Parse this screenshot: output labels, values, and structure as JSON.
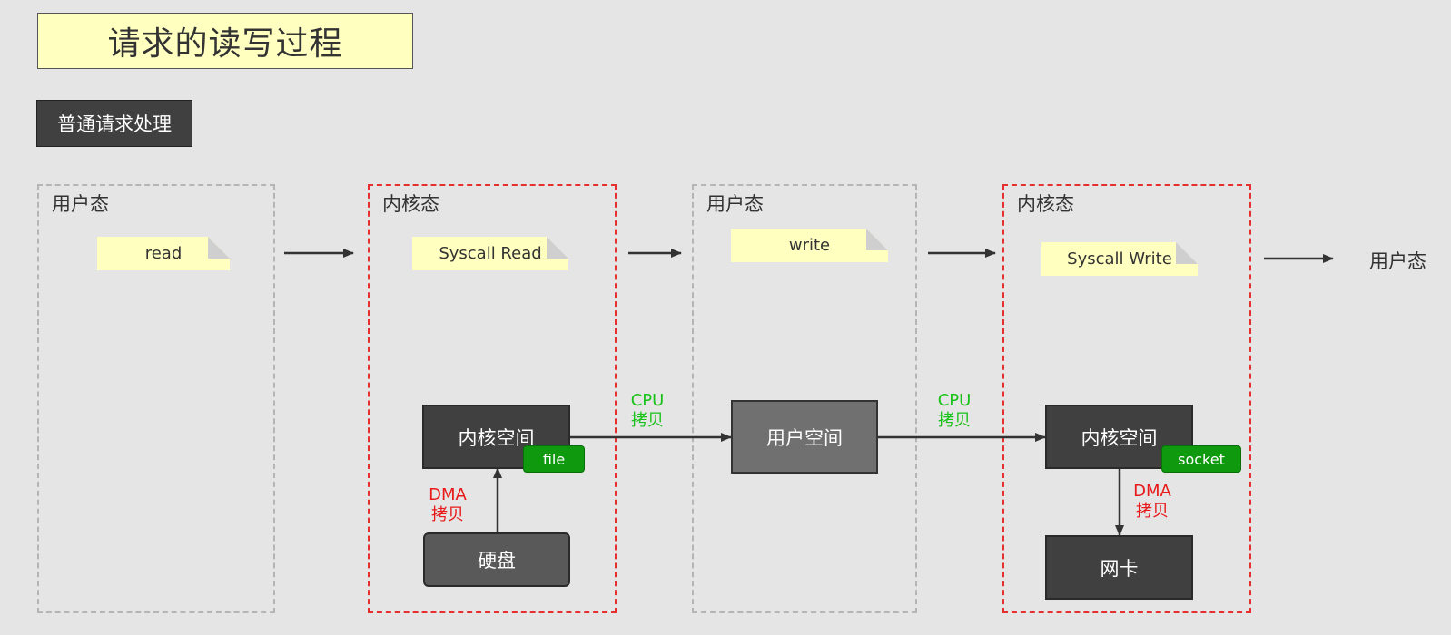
{
  "title": "请求的读写过程",
  "section": "普通请求处理",
  "zones": {
    "user1": "用户态",
    "kernel1": "内核态",
    "user2": "用户态",
    "kernel2": "内核态"
  },
  "notes": {
    "read": "read",
    "syscall_read": "Syscall Read",
    "write": "write",
    "syscall_write": "Syscall Write"
  },
  "final_state": "用户态",
  "nodes": {
    "kernel_space_1": "内核空间",
    "file_badge": "file",
    "disk": "硬盘",
    "user_space": "用户空间",
    "kernel_space_2": "内核空间",
    "socket_badge": "socket",
    "nic": "网卡"
  },
  "edge_labels": {
    "cpu_copy_1": [
      "CPU",
      "拷贝"
    ],
    "cpu_copy_2": [
      "CPU",
      "拷贝"
    ],
    "dma_copy_1": [
      "DMA",
      "拷贝"
    ],
    "dma_copy_2": [
      "DMA",
      "拷贝"
    ]
  },
  "colors": {
    "kernel_border": "#e53030",
    "user_border": "#b5b5b5",
    "cpu_label": "#19c219",
    "dma_label": "#e81919",
    "badge": "#0f990f",
    "note": "#ffffc0"
  }
}
